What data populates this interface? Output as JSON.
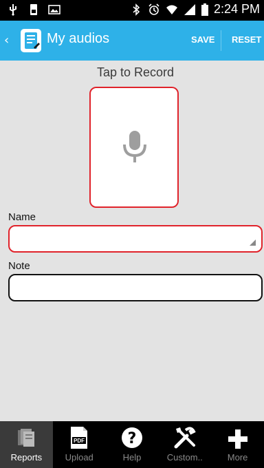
{
  "status_bar": {
    "time": "2:24 PM",
    "left_icons": [
      "usb-icon",
      "sim-icon",
      "image-icon"
    ],
    "right_icons": [
      "bluetooth-icon",
      "alarm-icon",
      "wifi-icon",
      "signal-icon",
      "battery-icon"
    ]
  },
  "action_bar": {
    "back_glyph": "‹",
    "title": "My audios",
    "save_label": "SAVE",
    "reset_label": "RESET",
    "background_color": "#2eb1e8"
  },
  "recorder": {
    "prompt": "Tap to Record",
    "icon": "microphone-icon",
    "accent_color": "#e0222a"
  },
  "form": {
    "name_label": "Name",
    "name_value": "",
    "note_label": "Note",
    "note_value": ""
  },
  "bottom_nav": {
    "tabs": [
      {
        "label": "Reports",
        "icon": "reports-icon",
        "active": true
      },
      {
        "label": "Upload",
        "icon": "pdf-icon",
        "active": false
      },
      {
        "label": "Help",
        "icon": "help-icon",
        "active": false
      },
      {
        "label": "Custom..",
        "icon": "tools-icon",
        "active": false
      },
      {
        "label": "More",
        "icon": "plus-icon",
        "active": false
      }
    ]
  }
}
